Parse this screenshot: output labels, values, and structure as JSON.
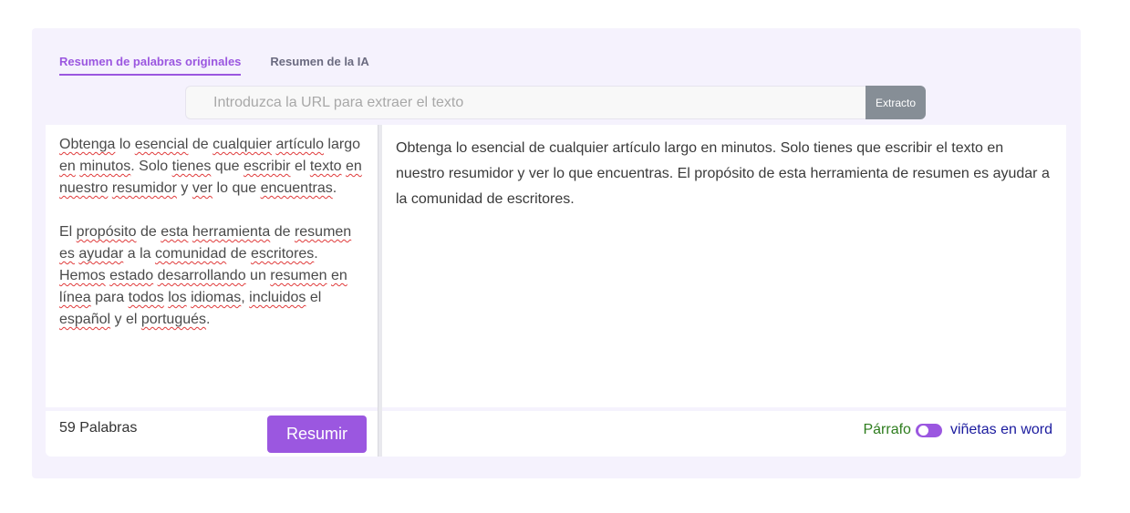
{
  "tabs": [
    {
      "label": "Resumen de palabras originales",
      "active": true
    },
    {
      "label": "Resumen de la IA",
      "active": false
    }
  ],
  "url_bar": {
    "placeholder": "Introduzca la URL para extraer el texto",
    "value": "",
    "extract_label": "Extracto"
  },
  "input_text": {
    "paragraph1": [
      {
        "t": "Obtenga",
        "sp": true
      },
      {
        "t": " lo ",
        "sp": false
      },
      {
        "t": "esencial",
        "sp": true
      },
      {
        "t": " de ",
        "sp": false
      },
      {
        "t": "cualquier",
        "sp": true
      },
      {
        "t": " ",
        "sp": false
      },
      {
        "t": "artículo",
        "sp": true
      },
      {
        "t": " largo ",
        "sp": false
      },
      {
        "t": "en",
        "sp": true
      },
      {
        "t": " ",
        "sp": false
      },
      {
        "t": "minutos",
        "sp": true
      },
      {
        "t": ". Solo ",
        "sp": false
      },
      {
        "t": "tienes",
        "sp": true
      },
      {
        "t": " que ",
        "sp": false
      },
      {
        "t": "escribir",
        "sp": true
      },
      {
        "t": " el ",
        "sp": false
      },
      {
        "t": "texto",
        "sp": true
      },
      {
        "t": " ",
        "sp": false
      },
      {
        "t": "en",
        "sp": true
      },
      {
        "t": " ",
        "sp": false
      },
      {
        "t": "nuestro",
        "sp": true
      },
      {
        "t": " ",
        "sp": false
      },
      {
        "t": "resumidor",
        "sp": true
      },
      {
        "t": " y ",
        "sp": false
      },
      {
        "t": "ver",
        "sp": true
      },
      {
        "t": " lo que ",
        "sp": false
      },
      {
        "t": "encuentras",
        "sp": true
      },
      {
        "t": ".",
        "sp": false
      }
    ],
    "paragraph2": [
      {
        "t": "El ",
        "sp": false
      },
      {
        "t": "propósito",
        "sp": true
      },
      {
        "t": " de ",
        "sp": false
      },
      {
        "t": "esta",
        "sp": true
      },
      {
        "t": " ",
        "sp": false
      },
      {
        "t": "herramienta",
        "sp": true
      },
      {
        "t": " de ",
        "sp": false
      },
      {
        "t": "resumen",
        "sp": true
      },
      {
        "t": " ",
        "sp": false
      },
      {
        "t": "es",
        "sp": true
      },
      {
        "t": " ",
        "sp": false
      },
      {
        "t": "ayudar",
        "sp": true
      },
      {
        "t": " a la ",
        "sp": false
      },
      {
        "t": "comunidad",
        "sp": true
      },
      {
        "t": " de ",
        "sp": false
      },
      {
        "t": "escritores",
        "sp": true
      },
      {
        "t": ". ",
        "sp": false
      },
      {
        "t": "Hemos",
        "sp": true
      },
      {
        "t": " ",
        "sp": false
      },
      {
        "t": "estado",
        "sp": true
      },
      {
        "t": " ",
        "sp": false
      },
      {
        "t": "desarrollando",
        "sp": true
      },
      {
        "t": " un ",
        "sp": false
      },
      {
        "t": "resumen",
        "sp": true
      },
      {
        "t": " ",
        "sp": false
      },
      {
        "t": "en",
        "sp": true
      },
      {
        "t": " ",
        "sp": false
      },
      {
        "t": "línea",
        "sp": true
      },
      {
        "t": " para ",
        "sp": false
      },
      {
        "t": "todos",
        "sp": true
      },
      {
        "t": " ",
        "sp": false
      },
      {
        "t": "los",
        "sp": true
      },
      {
        "t": " ",
        "sp": false
      },
      {
        "t": "idiomas",
        "sp": true
      },
      {
        "t": ", ",
        "sp": false
      },
      {
        "t": "incluidos",
        "sp": true
      },
      {
        "t": " el ",
        "sp": false
      },
      {
        "t": "español",
        "sp": true
      },
      {
        "t": " y el ",
        "sp": false
      },
      {
        "t": "portugués",
        "sp": true
      },
      {
        "t": ".",
        "sp": false
      }
    ]
  },
  "output_text": "Obtenga lo esencial de cualquier artículo largo en minutos. Solo tienes que escribir el texto en nuestro resumidor y ver lo que encuentras. El propósito de esta herramienta de resumen es ayudar a la comunidad de escritores.",
  "footer": {
    "word_count": "59 Palabras",
    "summarize_label": "Resumir",
    "mode_left_label": "Párrafo",
    "mode_right_label": "viñetas en word",
    "toggle_on": true
  },
  "colors": {
    "accent": "#9b57e0",
    "panel_bg": "#f5f2fd",
    "extract_bg": "#868e96",
    "mode_left": "#2e7d1e",
    "mode_right": "#1a1a9e"
  }
}
